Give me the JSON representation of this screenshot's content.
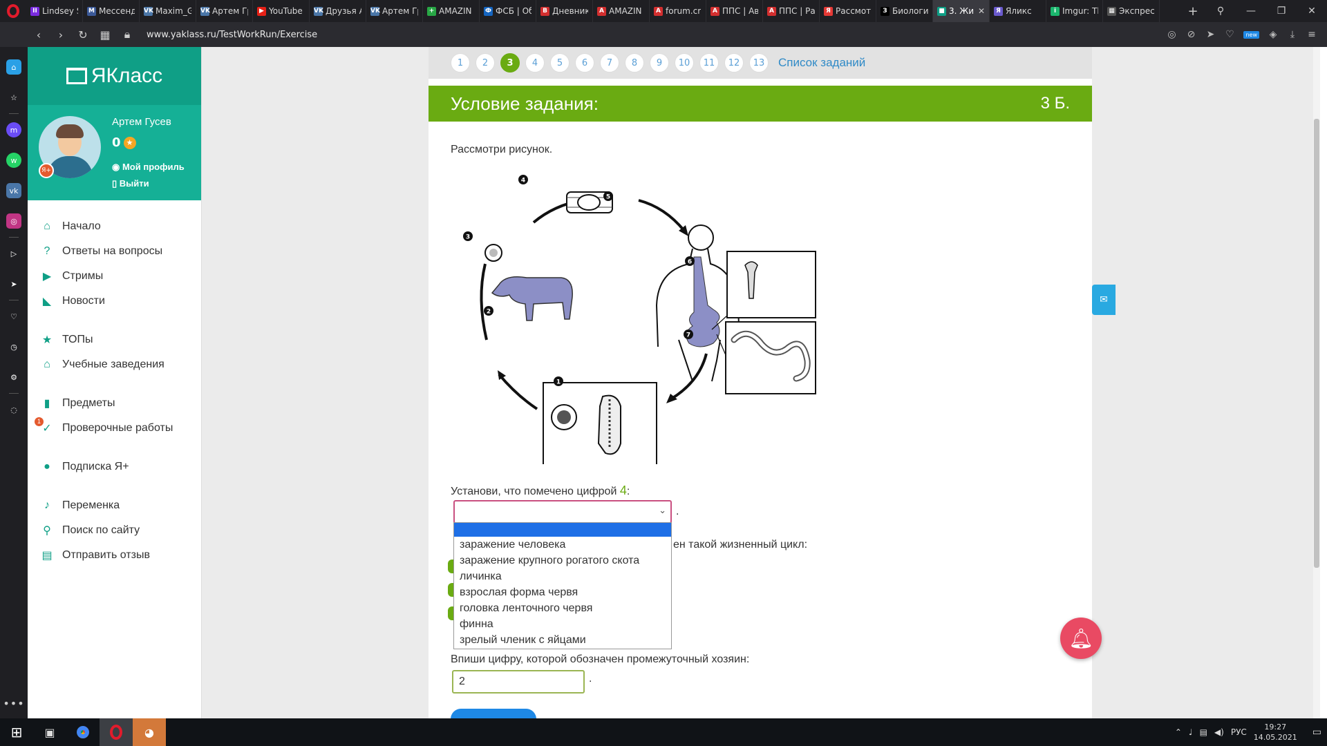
{
  "browser": {
    "tabs": [
      {
        "title": "Lindsey S",
        "color": "#7a2be0",
        "glyph": "II"
      },
      {
        "title": "Мессенд",
        "color": "#3b5998",
        "glyph": "M"
      },
      {
        "title": "Maxim_G",
        "color": "#4a76a8",
        "glyph": "VK"
      },
      {
        "title": "Артем Гр",
        "color": "#4a76a8",
        "glyph": "VK"
      },
      {
        "title": "YouTube",
        "color": "#e62117",
        "glyph": "▶"
      },
      {
        "title": "Друзья А",
        "color": "#4a76a8",
        "glyph": "VK"
      },
      {
        "title": "Артем Гр",
        "color": "#4a76a8",
        "glyph": "VK"
      },
      {
        "title": "AMAZIN",
        "color": "#28a745",
        "glyph": "+"
      },
      {
        "title": "ФСБ | Об",
        "color": "#1565c0",
        "glyph": "Ф"
      },
      {
        "title": "Дневник",
        "color": "#d32f2f",
        "glyph": "B"
      },
      {
        "title": "AMAZIN",
        "color": "#d32f2f",
        "glyph": "A"
      },
      {
        "title": "forum.cr",
        "color": "#d32f2f",
        "glyph": "A"
      },
      {
        "title": "ППС | Ав",
        "color": "#d32f2f",
        "glyph": "A"
      },
      {
        "title": "ППС | Ра",
        "color": "#d32f2f",
        "glyph": "A"
      },
      {
        "title": "Рассмотр",
        "color": "#e53935",
        "glyph": "Я"
      },
      {
        "title": "Биологи",
        "color": "#000000",
        "glyph": "З"
      },
      {
        "title": "3. Жи",
        "color": "#0f9f86",
        "glyph": "■",
        "active": true
      },
      {
        "title": "Яликс",
        "color": "#6a5acd",
        "glyph": "Я"
      },
      {
        "title": "Imgur: Th",
        "color": "#1bb76e",
        "glyph": "i"
      },
      {
        "title": "Экспрес",
        "color": "#555555",
        "glyph": "▦"
      }
    ],
    "url": "www.yaklass.ru/TestWorkRun/Exercise"
  },
  "site": {
    "logo": "ЯКласс",
    "user_name": "Артем Гусев",
    "points": "0",
    "plus_badge": "Я+",
    "profile_link": "Мой профиль",
    "logout_link": "Выйти",
    "menu": [
      {
        "label": "Начало",
        "icon": "home-icon",
        "glyph": "⌂"
      },
      {
        "label": "Ответы на вопросы",
        "icon": "question-icon",
        "glyph": "?"
      },
      {
        "label": "Стримы",
        "icon": "stream-icon",
        "glyph": "▶"
      },
      {
        "label": "Новости",
        "icon": "news-icon",
        "glyph": "◣"
      },
      {
        "label": "ТОПы",
        "icon": "star-icon",
        "glyph": "★",
        "gap": true
      },
      {
        "label": "Учебные заведения",
        "icon": "school-icon",
        "glyph": "⌂"
      },
      {
        "label": "Предметы",
        "icon": "books-icon",
        "glyph": "▮",
        "gap": true
      },
      {
        "label": "Проверочные работы",
        "icon": "test-icon",
        "glyph": "✓",
        "count": "1"
      },
      {
        "label": "Подписка Я+",
        "icon": "subscription-icon",
        "glyph": "●",
        "gap": true
      },
      {
        "label": "Переменка",
        "icon": "bell-icon",
        "glyph": "♪",
        "gap": true
      },
      {
        "label": "Поиск по сайту",
        "icon": "search-icon",
        "glyph": "⚲"
      },
      {
        "label": "Отправить отзыв",
        "icon": "feedback-icon",
        "glyph": "▤"
      }
    ]
  },
  "exercise": {
    "pages": [
      "1",
      "2",
      "3",
      "4",
      "5",
      "6",
      "7",
      "8",
      "9",
      "10",
      "11",
      "12",
      "13"
    ],
    "current_page": "3",
    "task_list_link": "Список заданий",
    "condition_title": "Условие задания:",
    "condition_points": "3 Б.",
    "intro": "Рассмотри рисунок.",
    "q1_prefix": "Установи, что помечено цифрой",
    "q1_number": "4",
    "q1_suffix": ":",
    "dropdown_options": [
      "заражение человека",
      "заражение крупного рогатого скота",
      "личинка",
      "взрослая форма червя",
      "головка ленточного червя",
      "финна",
      "зрелый членик с яйцами"
    ],
    "q2_fragment": "ен такой жизненный цикл:",
    "q3_label": "Впиши цифру, которой обозначен промежуточный хозяин:",
    "q3_value": "2",
    "figure_labels": [
      "1",
      "2",
      "3",
      "4",
      "5",
      "6",
      "7"
    ]
  },
  "taskbar": {
    "lang": "РУС",
    "time": "19:27",
    "date": "14.05.2021"
  }
}
